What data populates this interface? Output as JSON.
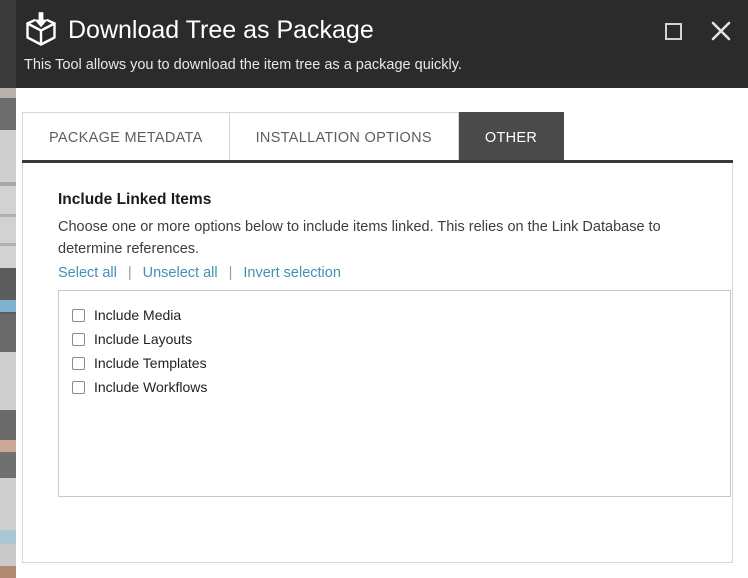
{
  "window": {
    "icon": "package-download-icon",
    "title": "Download Tree as Package",
    "subtitle": "This Tool allows you to download the item tree as a package quickly.",
    "header_bg": "#2b2b2b",
    "maximize_label": "Maximize",
    "close_label": "Close"
  },
  "tabs": [
    {
      "label": "PACKAGE METADATA",
      "active": false
    },
    {
      "label": "INSTALLATION OPTIONS",
      "active": false
    },
    {
      "label": "OTHER",
      "active": true
    }
  ],
  "content": {
    "section_title": "Include Linked Items",
    "section_description": "Choose one or more options below to include items linked. This relies on the Link Database to determine references.",
    "links": [
      {
        "label": "Select all"
      },
      {
        "label": "Unselect all"
      },
      {
        "label": "Invert selection"
      }
    ],
    "link_separator": "|",
    "link_color": "#4490b5",
    "checkboxes": [
      {
        "label": "Include Media",
        "checked": false
      },
      {
        "label": "Include Layouts",
        "checked": false
      },
      {
        "label": "Include Templates",
        "checked": false
      },
      {
        "label": "Include Workflows",
        "checked": false
      }
    ]
  }
}
